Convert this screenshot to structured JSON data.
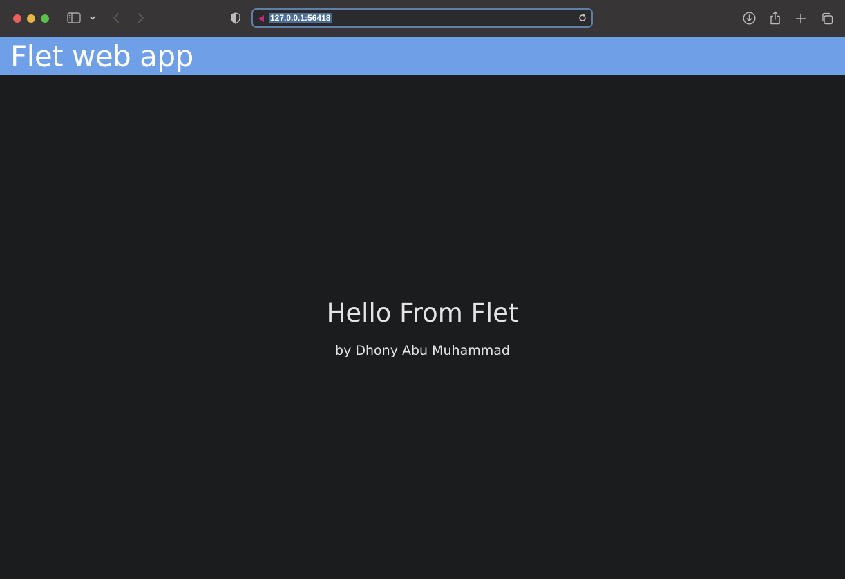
{
  "browser": {
    "url": "127.0.0.1:56418",
    "icons": {
      "sidebar": "sidebar-icon",
      "chevron": "chevron-down-icon",
      "back": "back-arrow-icon",
      "forward": "forward-arrow-icon",
      "privacy": "shield-icon",
      "favicon": "flet-logo-icon",
      "reload": "reload-icon",
      "download": "download-icon",
      "share": "share-icon",
      "new_tab": "plus-icon",
      "tabs": "tab-overview-icon"
    },
    "colors": {
      "toolbar": "#383536",
      "address_focus": "#5f7fa8",
      "url_selection": "#4c6d95"
    }
  },
  "appbar": {
    "title": "Flet web app",
    "color": "#6f9fe7"
  },
  "main": {
    "heading": "Hello From Flet",
    "byline": "by Dhony Abu Muhammad",
    "background": "#1b1c1e"
  }
}
